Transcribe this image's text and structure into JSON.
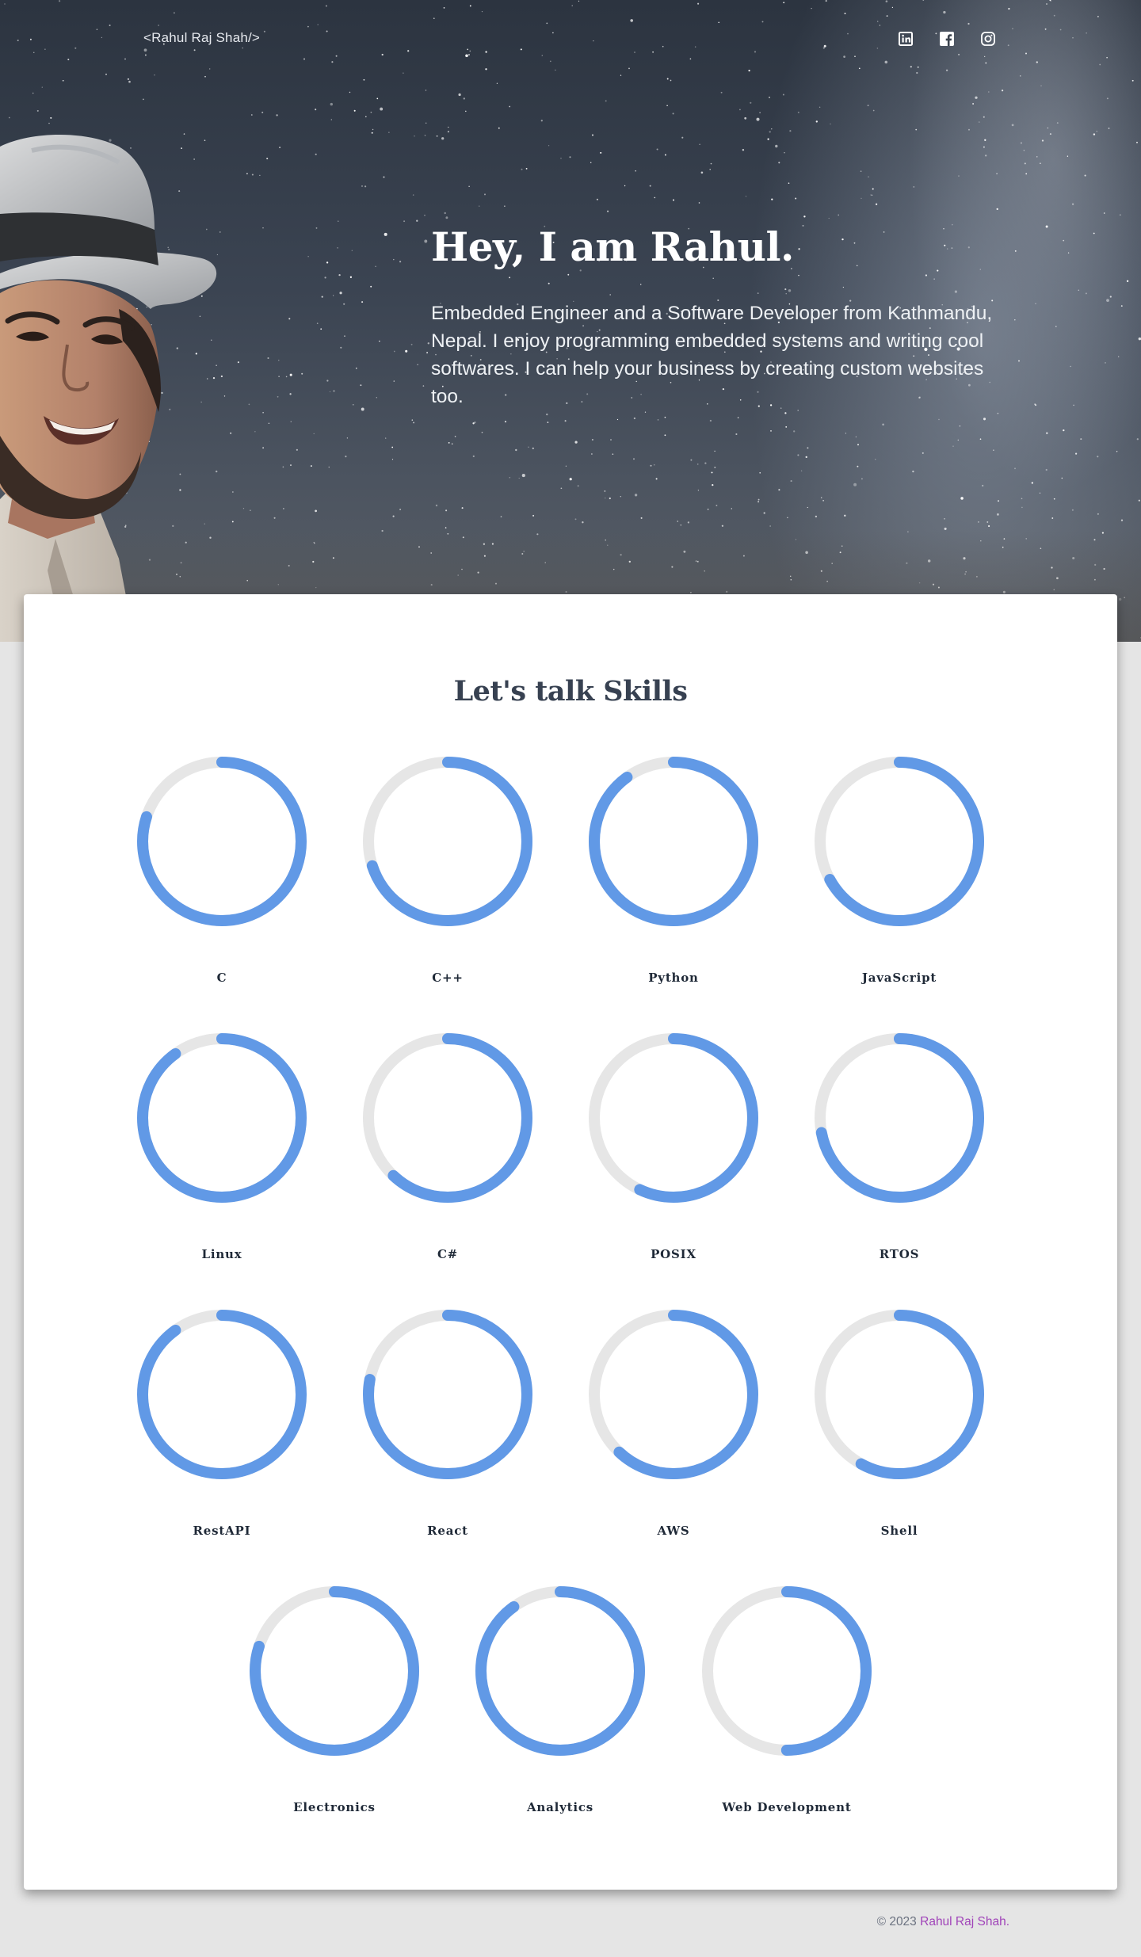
{
  "header": {
    "brand": "<Rahul Raj Shah/>",
    "social_icons": [
      "linkedin-icon",
      "facebook-icon",
      "instagram-icon"
    ]
  },
  "hero": {
    "title": "Hey, I am Rahul.",
    "description": "Embedded Engineer and a Software Developer from Kathmandu, Nepal. I enjoy programming embedded systems and writing cool softwares. I can help your business by creating custom websites too."
  },
  "skills": {
    "title": "Let's talk Skills",
    "items": [
      {
        "name": "C",
        "percent": 80
      },
      {
        "name": "C++",
        "percent": 70
      },
      {
        "name": "Python",
        "percent": 90
      },
      {
        "name": "JavaScript",
        "percent": 67
      },
      {
        "name": "Linux",
        "percent": 90
      },
      {
        "name": "C#",
        "percent": 62
      },
      {
        "name": "POSIX",
        "percent": 57
      },
      {
        "name": "RTOS",
        "percent": 72
      },
      {
        "name": "RestAPI",
        "percent": 90
      },
      {
        "name": "React",
        "percent": 78
      },
      {
        "name": "AWS",
        "percent": 62
      },
      {
        "name": "Shell",
        "percent": 58
      },
      {
        "name": "Electronics",
        "percent": 80
      },
      {
        "name": "Analytics",
        "percent": 90
      },
      {
        "name": "Web Development",
        "percent": 50
      }
    ]
  },
  "footer": {
    "copyright": "© 2023",
    "owner": "Rahul Raj Shah."
  },
  "colors": {
    "accent_ring": "#6199e6",
    "ring_track": "#e6e6e6",
    "footer_link": "#a043b9",
    "heading_text": "#374151"
  }
}
